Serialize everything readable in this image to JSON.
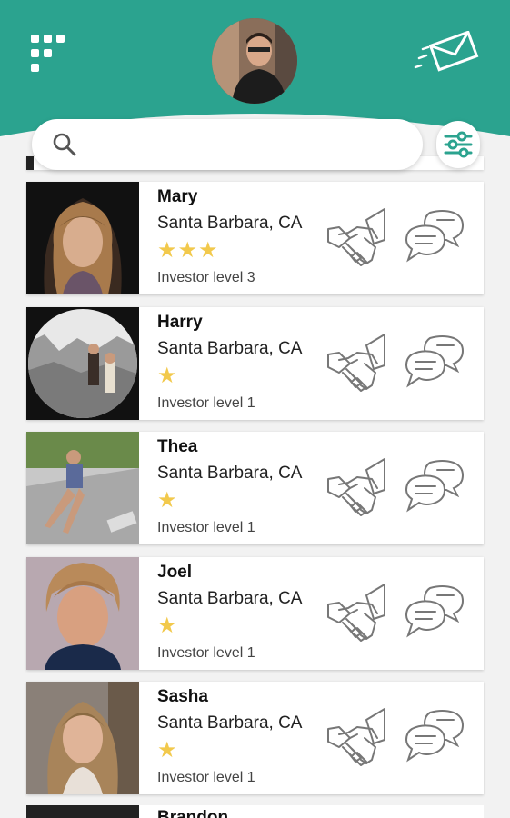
{
  "colors": {
    "header": "#2ba38f",
    "star": "#f2c94c"
  },
  "header": {
    "menu_icon": "grid-dots-icon",
    "mail_icon": "envelope-icon"
  },
  "search": {
    "placeholder": "",
    "value": "",
    "filter_icon": "sliders-icon"
  },
  "contacts": [
    {
      "name": "Mary",
      "location": "Santa Barbara, CA",
      "stars": 3,
      "stars_text": "★★★",
      "level": "Investor level 3"
    },
    {
      "name": "Harry",
      "location": "Santa Barbara, CA",
      "stars": 1,
      "stars_text": "★",
      "level": "Investor level 1"
    },
    {
      "name": "Thea",
      "location": "Santa Barbara, CA",
      "stars": 1,
      "stars_text": "★",
      "level": "Investor level 1"
    },
    {
      "name": "Joel",
      "location": "Santa Barbara, CA",
      "stars": 1,
      "stars_text": "★",
      "level": "Investor level 1"
    },
    {
      "name": "Sasha",
      "location": "Santa Barbara, CA",
      "stars": 1,
      "stars_text": "★",
      "level": "Investor level 1"
    }
  ],
  "partial_next": {
    "name": "Brandon"
  }
}
